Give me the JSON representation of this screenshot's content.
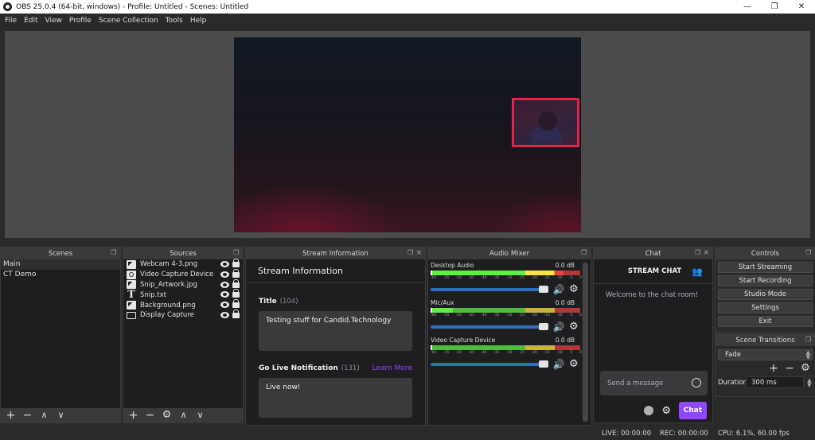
{
  "window": {
    "title": "OBS 25.0.4 (64-bit, windows) - Profile: Untitled - Scenes: Untitled",
    "controls": {
      "minimize": "—",
      "maximize": "❐",
      "close": "✕"
    }
  },
  "menu": [
    "File",
    "Edit",
    "View",
    "Profile",
    "Scene Collection",
    "Tools",
    "Help"
  ],
  "scenes": {
    "title": "Scenes",
    "items": [
      {
        "label": "Main",
        "selected": true
      },
      {
        "label": "CT Demo",
        "selected": false
      }
    ],
    "toolbar": {
      "add": "+",
      "remove": "−",
      "up": "∧",
      "down": "∨"
    }
  },
  "sources": {
    "title": "Sources",
    "items": [
      {
        "label": "Webcam 4-3.png",
        "icon": "image-icon",
        "visible": true,
        "locked": false
      },
      {
        "label": "Video Capture Device",
        "icon": "camera-icon",
        "visible": true,
        "locked": false
      },
      {
        "label": "Snip_Artwork.jpg",
        "icon": "image-icon",
        "visible": true,
        "locked": false
      },
      {
        "label": "Snip.txt",
        "icon": "text-icon",
        "visible": true,
        "locked": false
      },
      {
        "label": "Background.png",
        "icon": "image-icon",
        "visible": true,
        "locked": false
      },
      {
        "label": "Display Capture",
        "icon": "display-icon",
        "visible": true,
        "locked": false
      }
    ],
    "toolbar": {
      "add": "+",
      "remove": "−",
      "settings": "⚙",
      "up": "∧",
      "down": "∨"
    }
  },
  "stream_info": {
    "dock_title": "Stream Information",
    "heading": "Stream Information",
    "title_label": "Title",
    "title_count": "(104)",
    "title_value": "Testing stuff for Candid.Technology",
    "notification_label": "Go Live Notification",
    "notification_count": "(131)",
    "learn_more": "Learn More",
    "notification_value": "Live now!"
  },
  "audio_mixer": {
    "title": "Audio Mixer",
    "ticks": [
      "-60",
      "-55",
      "-50",
      "-45",
      "-40",
      "-35",
      "-30",
      "-25",
      "-20",
      "-15",
      "-10",
      "-5",
      "0"
    ],
    "channels": [
      {
        "name": "Desktop Audio",
        "db": "0.0 dB",
        "level_percent": 89,
        "volume_percent": 100,
        "muted": false
      },
      {
        "name": "Mic/Aux",
        "db": "0.0 dB",
        "level_percent": 15,
        "volume_percent": 100,
        "muted": false
      },
      {
        "name": "Video Capture Device",
        "db": "0.0 dB",
        "level_percent": 0,
        "volume_percent": 100,
        "muted": false
      }
    ],
    "volume_icon": "🔊",
    "gear_icon": "⚙"
  },
  "chat": {
    "dock_title": "Chat",
    "header": "STREAM CHAT",
    "welcome": "Welcome to the chat room!",
    "input_placeholder": "Send a message",
    "send_label": "Chat"
  },
  "controls": {
    "title": "Controls",
    "buttons": [
      "Start Streaming",
      "Start Recording",
      "Studio Mode",
      "Settings",
      "Exit"
    ]
  },
  "scene_transitions": {
    "title": "Scene Transitions",
    "selected": "Fade",
    "duration_label": "Duration",
    "duration_value": "300 ms"
  },
  "status": {
    "live": "LIVE: 00:00:00",
    "rec": "REC: 00:00:00",
    "cpu": "CPU: 6.1%, 60.00 fps"
  }
}
